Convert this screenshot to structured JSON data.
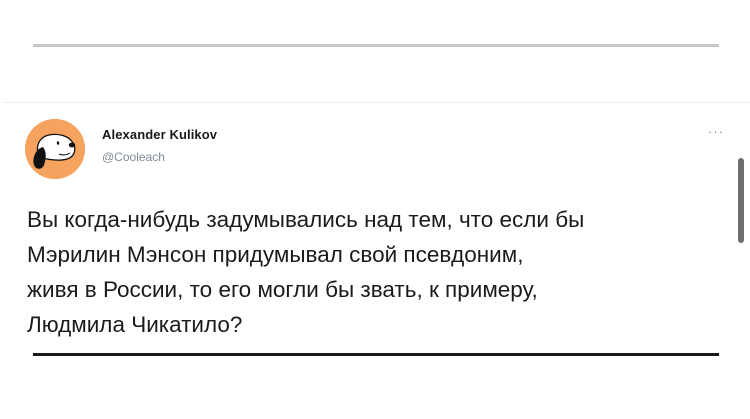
{
  "tweet": {
    "author_name": "Alexander Kulikov",
    "author_handle": "@Cooleach",
    "more_label": "···",
    "text_lines": [
      "Вы когда-нибудь задумывались над тем, что если бы",
      "Мэрилин Мэнсон придумывал свой псевдоним,",
      "живя в России, то его могли бы звать, к примеру,",
      "Людмила Чикатило?"
    ]
  },
  "avatar": {
    "icon": "snoopy-avatar",
    "background": "#f5a35f"
  },
  "colors": {
    "name": "#1a1a1a",
    "handle": "#7c8a96",
    "text": "#1b1b1b",
    "rule_top": "#c8c8c8",
    "rule_bottom": "#1a1a1a"
  }
}
